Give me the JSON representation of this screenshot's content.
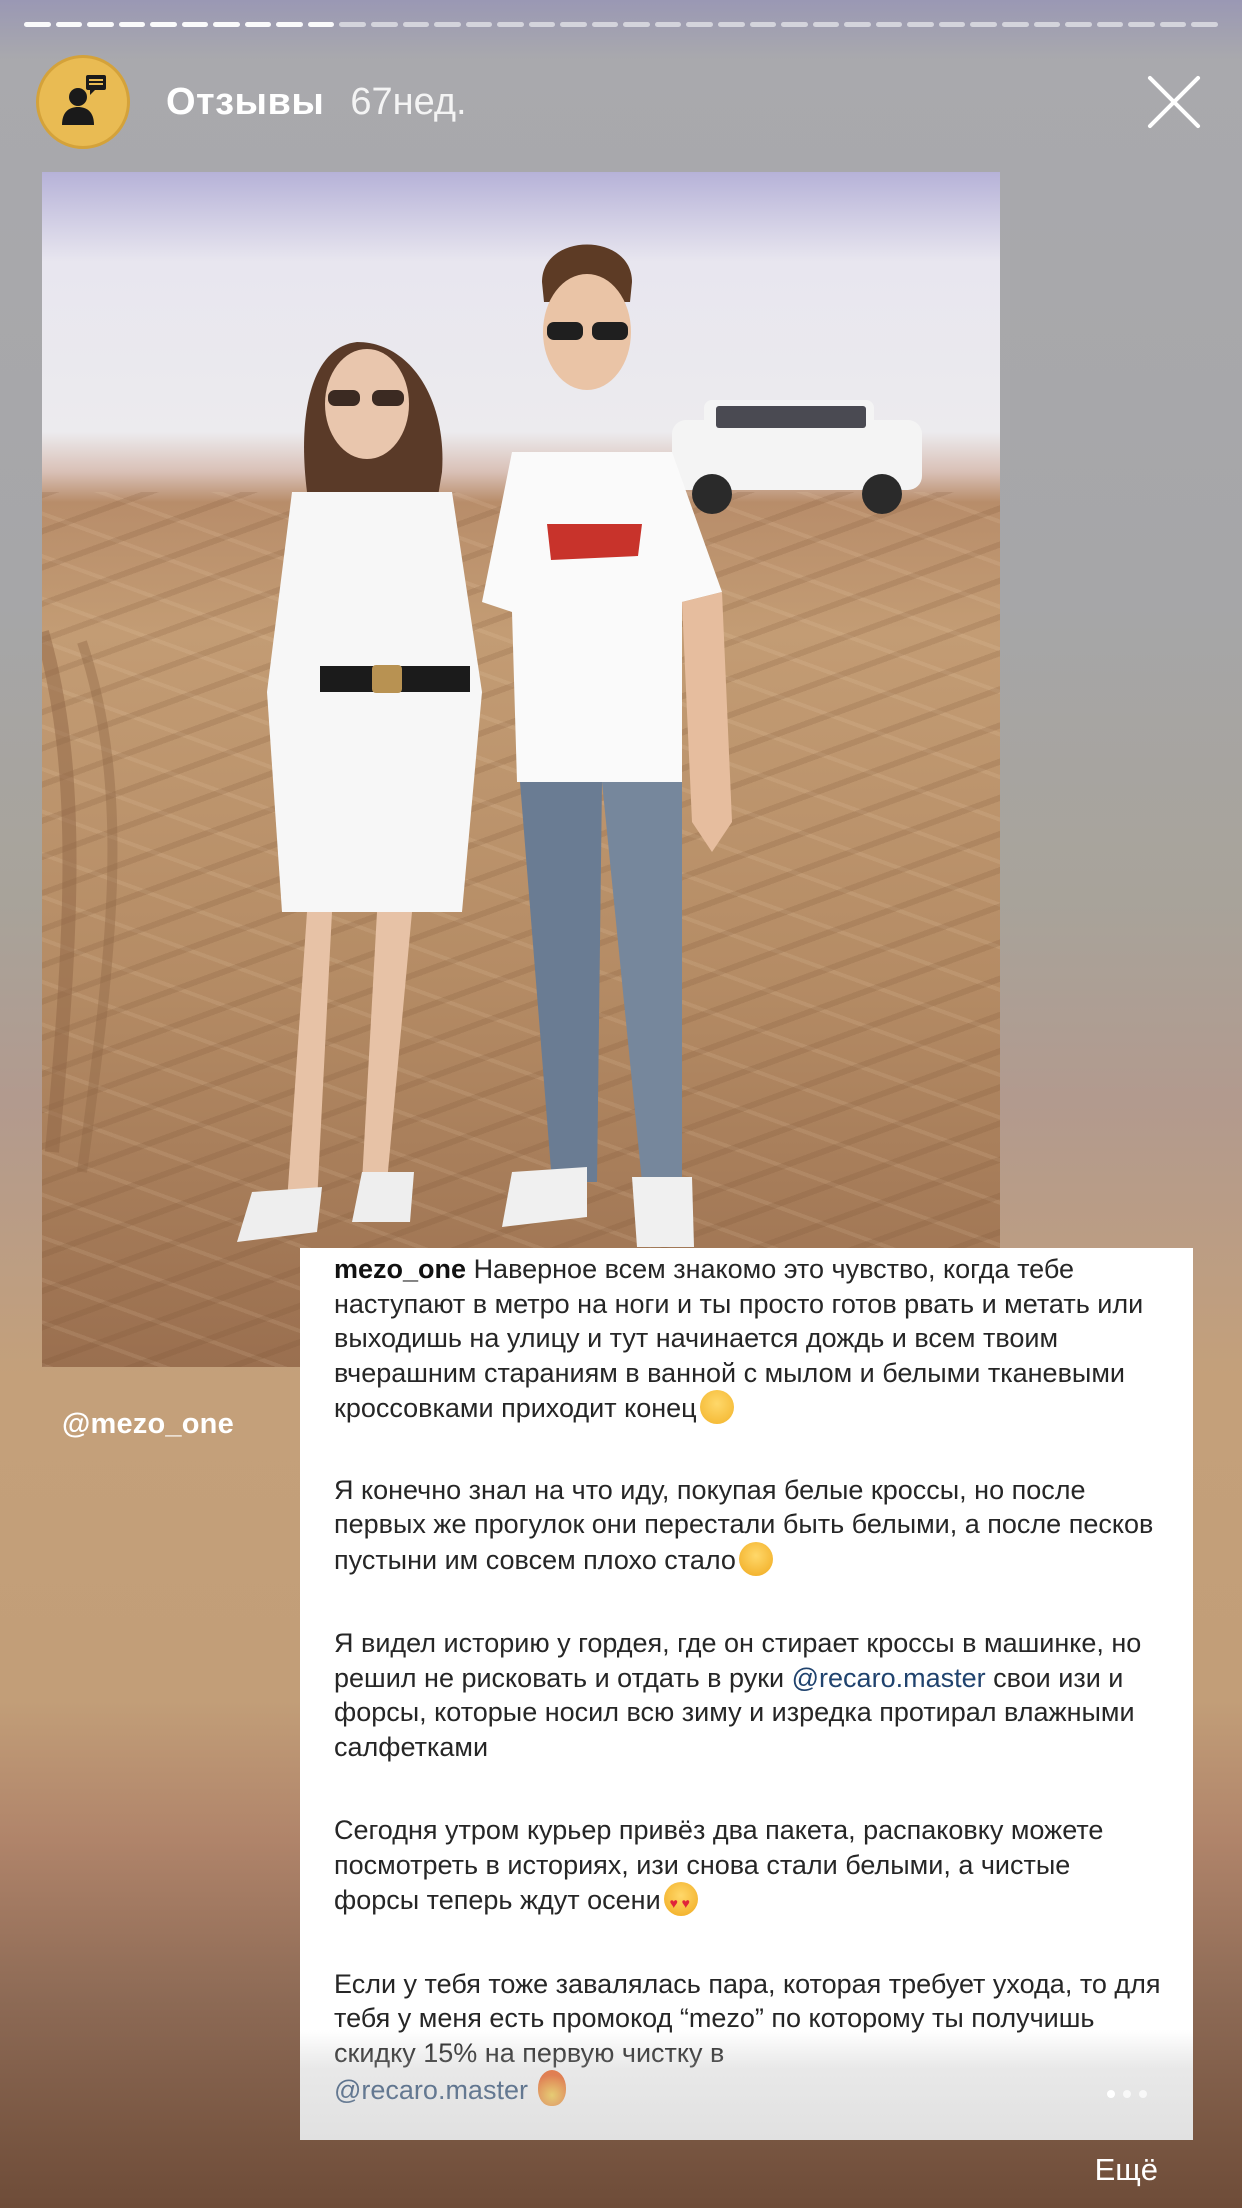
{
  "story": {
    "segments_total": 38,
    "segments_done": 10
  },
  "header": {
    "title": "Отзывы",
    "time": "67нед."
  },
  "photo": {
    "handle": "@mezo_one"
  },
  "review": {
    "author": "mezo_one",
    "p1": "Наверное всем знакомо это чувство, когда тебе наступают в метро на ноги и ты просто готов рвать и метать или выходишь на улицу и тут начинается дождь и всем твоим вчерашним стараниям в ванной с мылом и белыми тканевыми кроссовками приходит конец",
    "p2": "Я конечно знал на что иду, покупая белые кроссы, но после первых же прогулок они перестали быть белыми, а после песков пустыни им совсем плохо стало",
    "p3_before": "Я видел историю у гордея, где он стирает кроссы в машинке, но решил не рисковать и отдать в руки ",
    "p3_mention": "@recaro.master",
    "p3_after": " свои изи и форсы, которые носил всю зиму и изредка протирал влажными салфетками",
    "p4": "Сегодня утром курьер привёз два пакета, распаковку можете посмотреть в историях, изи снова стали белыми, а чистые форсы теперь ждут осени",
    "p5": "Если у тебя тоже завалялась пара, которая требует ухода, то для тебя у меня есть промокод “mezo” по которому ты получишь скидку 15% на первую чистку в",
    "p5_mention": "@recaro.master"
  },
  "footer": {
    "more": "Ещё"
  },
  "icons": {
    "avatar": "person-with-speech-bubble-icon",
    "close": "close-icon"
  },
  "colors": {
    "avatar_bg": "#e9bb53",
    "mention": "#20436e"
  }
}
